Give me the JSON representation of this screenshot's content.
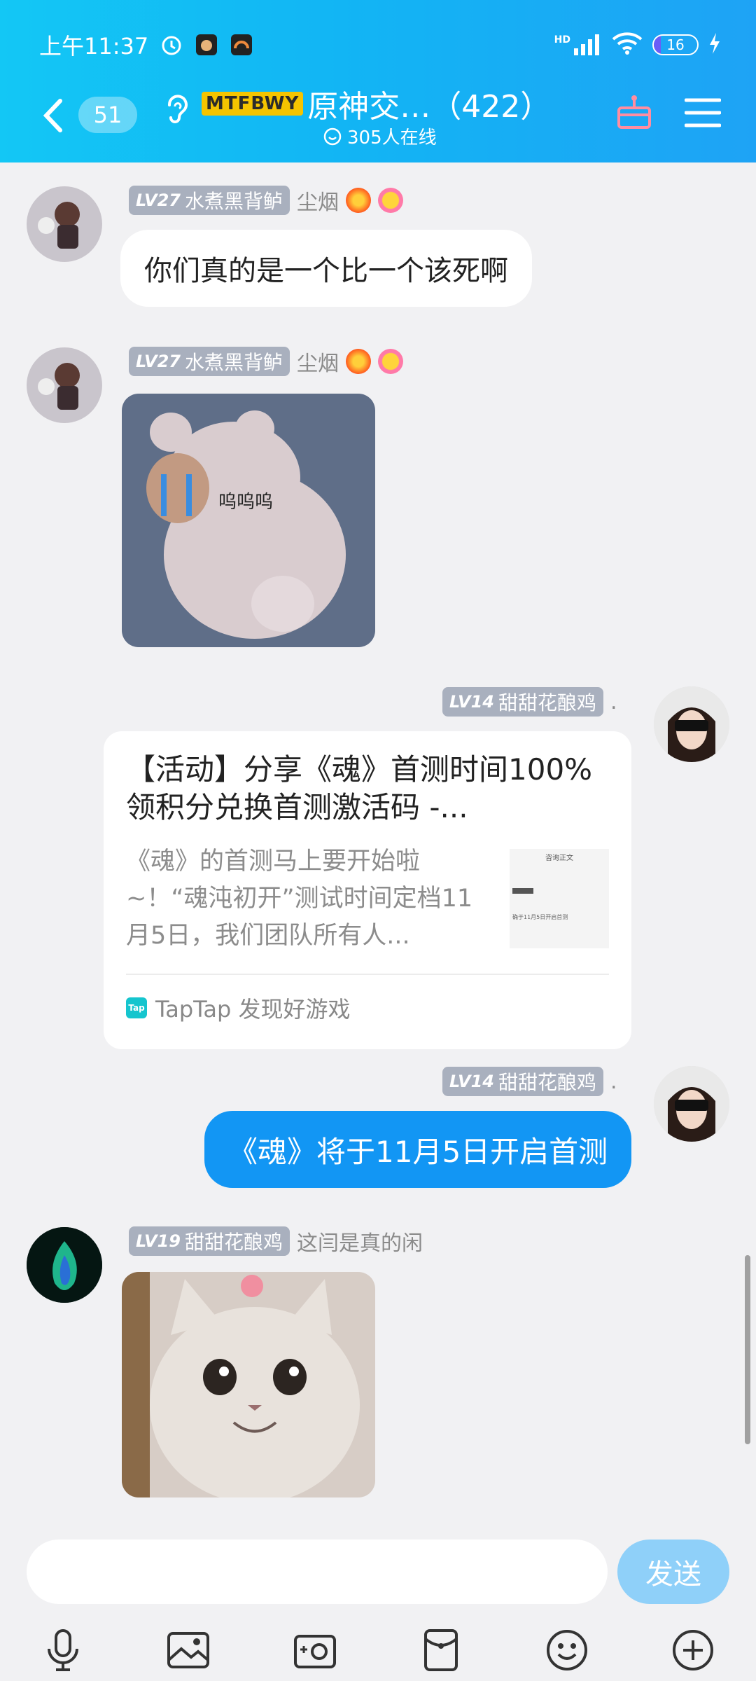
{
  "status_bar": {
    "time": "上午11:37",
    "battery": "16",
    "battery_level": 0.16,
    "network_label": "HD"
  },
  "header": {
    "unread_count": "51",
    "group_badge": "MTFBWY",
    "group_name": "原神交…（422）",
    "online_text": "305人在线"
  },
  "messages": [
    {
      "sender_level": "LV27",
      "sender_name": "水煮黑背鲈",
      "sender_title": "尘烟",
      "text": "你们真的是一个比一个该死啊"
    },
    {
      "sender_level": "LV27",
      "sender_name": "水煮黑背鲈",
      "sender_title": "尘烟",
      "sticker_caption": "呜呜呜"
    },
    {
      "sender_level": "LV14",
      "sender_name": "甜甜花酿鸡",
      "sender_title": ".",
      "card": {
        "title": "【活动】分享《魂》首测时间100%领积分兑换首测激活码 -...",
        "description": "《魂》的首测马上要开始啦~！“魂沌初开”测试时间定档11月5日，我们团队所有人...",
        "source": "TapTap 发现好游戏",
        "source_logo": "Tap",
        "thumb_heading": "咨询正文",
        "thumb_line": "确于11月5日开启首测"
      }
    },
    {
      "sender_level": "LV14",
      "sender_name": "甜甜花酿鸡",
      "sender_title": ".",
      "text": "《魂》将于11月5日开启首测"
    },
    {
      "sender_level": "LV19",
      "sender_name": "甜甜花酿鸡",
      "sender_title": "这闫是真的闲"
    }
  ],
  "composer": {
    "placeholder": "",
    "send_label": "发送"
  },
  "toolbar_icons": [
    "microphone-icon",
    "image-icon",
    "camera-icon",
    "red-packet-icon",
    "emoji-icon",
    "plus-icon"
  ],
  "colors": {
    "header_start": "#13c7f5",
    "header_end": "#1ea3f5",
    "own_bubble": "#1296f4",
    "send_button": "#8fd0f9"
  }
}
